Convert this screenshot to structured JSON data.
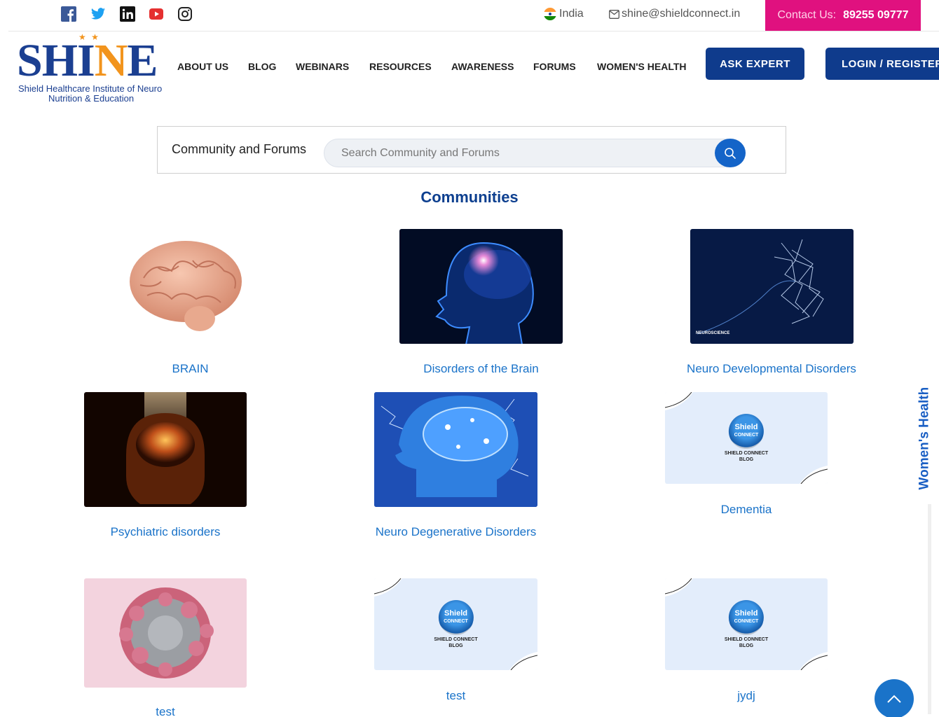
{
  "topbar": {
    "social": [
      "facebook-icon",
      "twitter-icon",
      "linkedin-icon",
      "youtube-icon",
      "instagram-icon"
    ],
    "country": "India",
    "email": "shine@shieldconnect.in",
    "contact_label": "Contact Us:",
    "contact_number": "89255 09777"
  },
  "logo": {
    "wordmark_prefix": "SH",
    "wordmark_i": "I",
    "wordmark_n": "N",
    "wordmark_e": "E",
    "line1": "Shield Healthcare Institute of Neuro",
    "line2": "Nutrition & Education"
  },
  "nav": {
    "items": [
      "ABOUT US",
      "BLOG",
      "WEBINARS",
      "RESOURCES",
      "AWARENESS",
      "FORUMS",
      "WOMEN'S HEALTH"
    ],
    "ask_expert": "ASK EXPERT",
    "login": "LOGIN / REGISTER"
  },
  "search": {
    "title": "Community and Forums",
    "placeholder": "Search Community and Forums",
    "value": ""
  },
  "communities": {
    "heading": "Communities",
    "items": [
      {
        "label": "BRAIN",
        "image": "brain-photo"
      },
      {
        "label": "Disorders of the Brain",
        "image": "head-scan-photo"
      },
      {
        "label": "Neuro Developmental Disorders",
        "image": "neuron-network-photo",
        "image_caption": "NEUROSCIENCE"
      },
      {
        "label": "Psychiatric disorders",
        "image": "glowing-brain-photo"
      },
      {
        "label": "Neuro Degenerative Disorders",
        "image": "electric-brain-photo"
      },
      {
        "label": "Dementia",
        "image": "shield-connect-blog-placeholder"
      },
      {
        "label": "test",
        "image": "cell-microscope-photo"
      },
      {
        "label": "test",
        "image": "shield-connect-blog-placeholder"
      },
      {
        "label": "jydj",
        "image": "shield-connect-blog-placeholder"
      }
    ],
    "placeholder_logo_top": "Shield",
    "placeholder_logo_bottom": "CONNECT",
    "placeholder_caption_1": "SHIELD CONNECT",
    "placeholder_caption_2": "BLOG"
  },
  "side_tab": "Women's Health",
  "colors": {
    "brand_blue": "#0f3b8c",
    "accent_pink": "#e0117f",
    "link_blue": "#1a73c9",
    "logo_orange": "#f2941d"
  }
}
